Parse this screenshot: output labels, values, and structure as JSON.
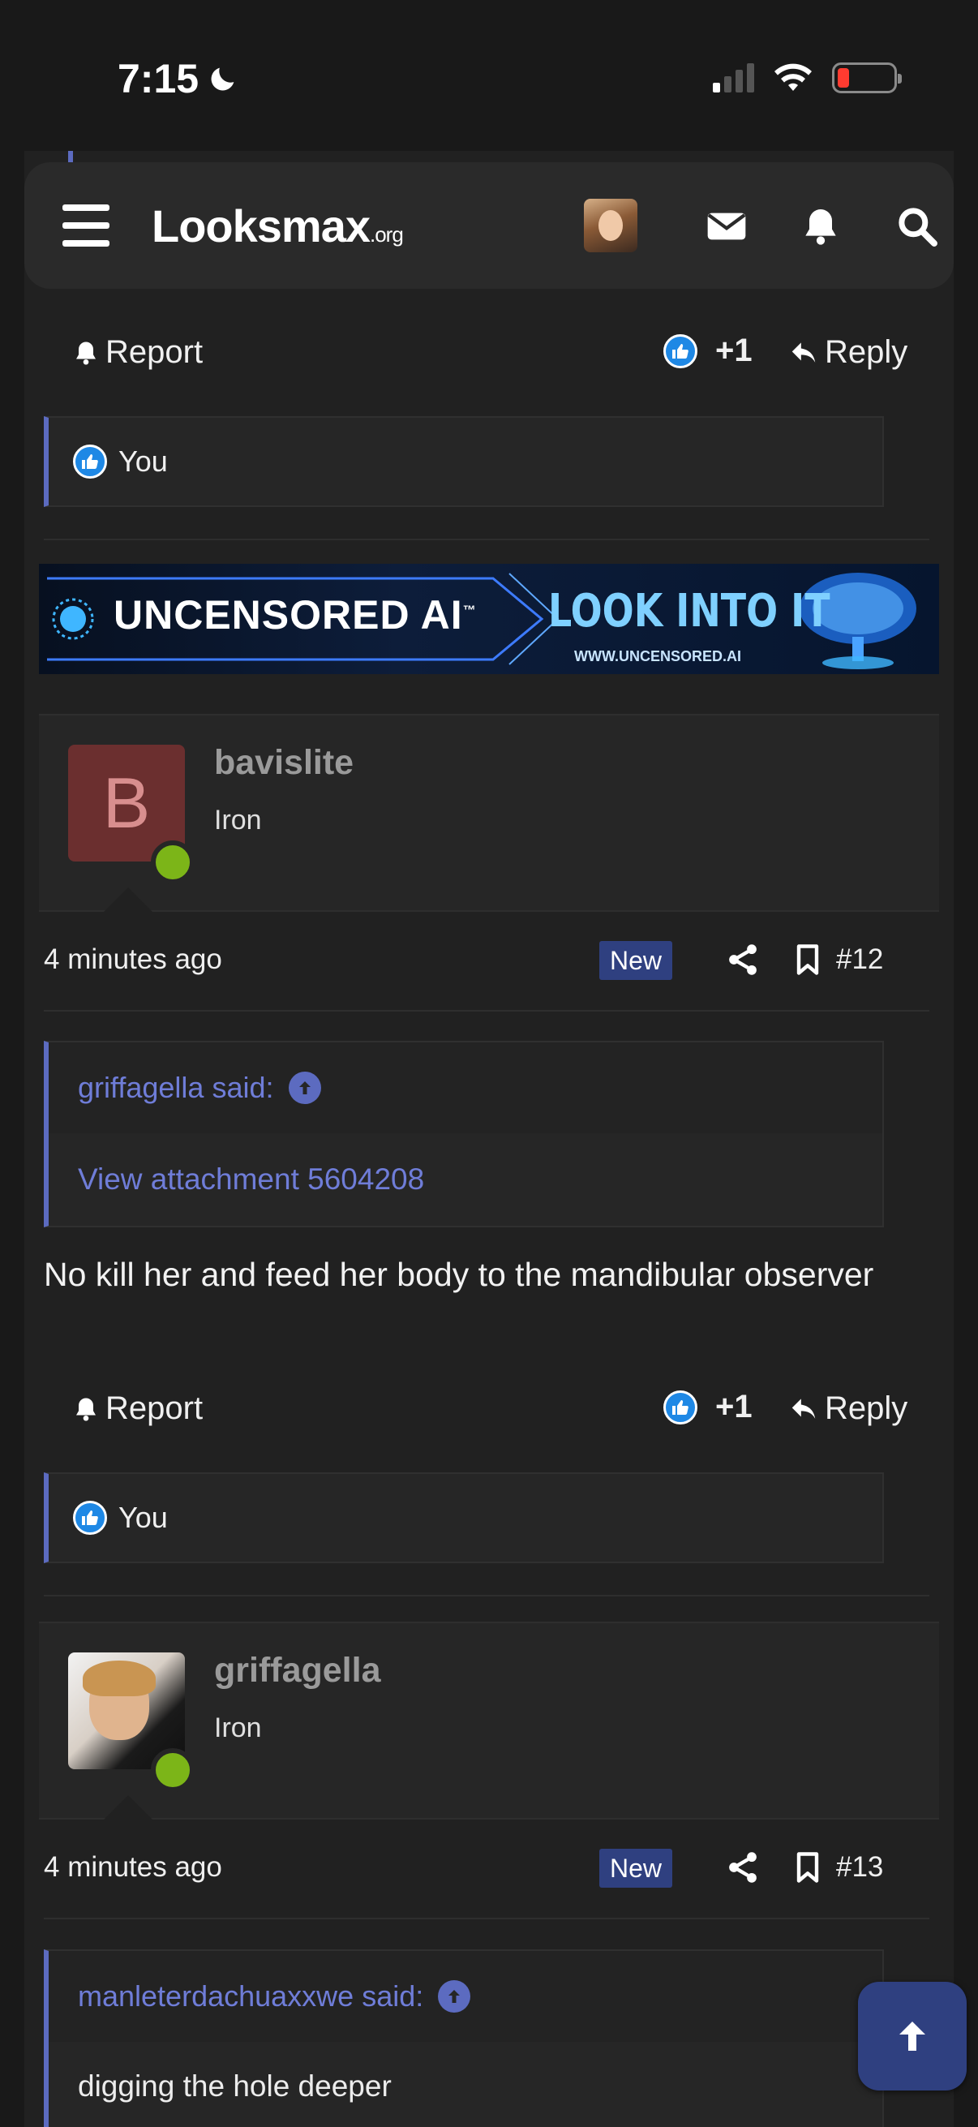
{
  "status_bar": {
    "time": "7:15"
  },
  "header": {
    "logo_main": "Lᴏᴏksmax",
    "logo_suffix": ".org"
  },
  "post11": {
    "report_label": "Report",
    "reaction_count": "+1",
    "reply_label": "Reply",
    "liked_by": "You"
  },
  "banner": {
    "left_text": "UNCENSORED AI",
    "tm": "™",
    "right_text": "LOOK INTO IT",
    "url": "WWW.UNCENSORED.AI"
  },
  "post12": {
    "avatar_letter": "B",
    "username": "bavislite",
    "rank": "Iron",
    "time": "4 minutes ago",
    "badge": "New",
    "number": "#12",
    "quote_author": "griffagella said:",
    "quote_content": "View attachment 5604208",
    "body": "No kill her and feed her body to the mandibular observer",
    "report_label": "Report",
    "reaction_count": "+1",
    "reply_label": "Reply",
    "liked_by": "You"
  },
  "post13": {
    "username": "griffagella",
    "rank": "Iron",
    "time": "4 minutes ago",
    "badge": "New",
    "number": "#13",
    "quote_author": "manleterdachuaxxwe said:",
    "quote_content": "digging the hole deeper"
  },
  "colors": {
    "accent": "#5c6bc0",
    "link": "#6f7dd8",
    "badge": "#2f4080",
    "online": "#7cb518",
    "like": "#1e88e5"
  }
}
